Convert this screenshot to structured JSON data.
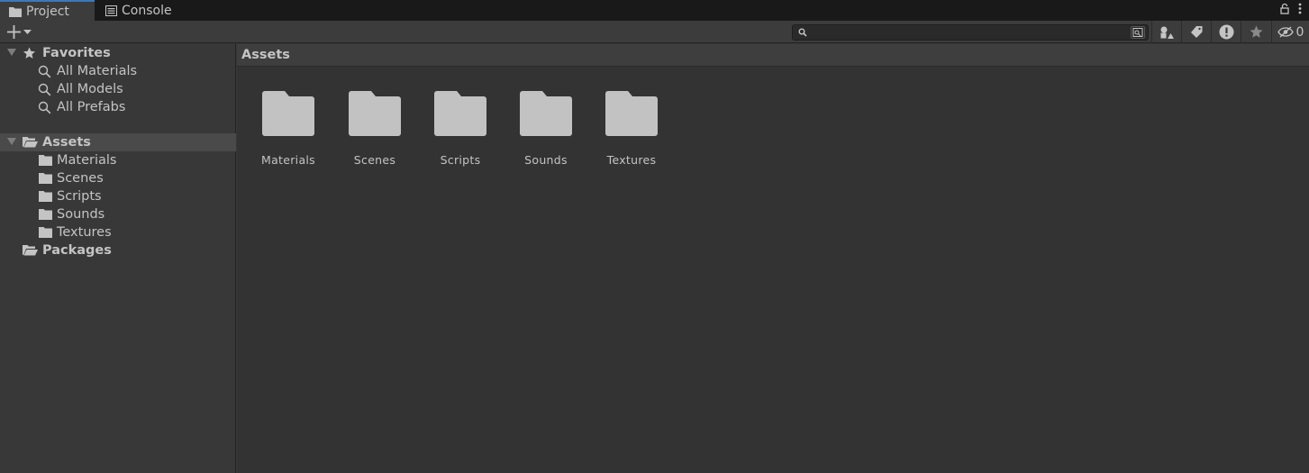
{
  "tabs": [
    {
      "label": "Project",
      "icon": "folder-icon",
      "active": true
    },
    {
      "label": "Console",
      "icon": "console-icon",
      "active": false
    }
  ],
  "toolbar": {
    "create_icon": "plus-icon",
    "search_value": "",
    "hidden_count": "0"
  },
  "tree": {
    "favorites": {
      "label": "Favorites",
      "items": [
        "All Materials",
        "All Models",
        "All Prefabs"
      ]
    },
    "assets": {
      "label": "Assets",
      "folders": [
        "Materials",
        "Scenes",
        "Scripts",
        "Sounds",
        "Textures"
      ]
    },
    "packages": {
      "label": "Packages"
    }
  },
  "content": {
    "breadcrumb": "Assets",
    "items": [
      "Materials",
      "Scenes",
      "Scripts",
      "Sounds",
      "Textures"
    ]
  },
  "colors": {
    "accent": "#3a79bb",
    "background": "#383838",
    "folder": "#c2c2c2"
  }
}
